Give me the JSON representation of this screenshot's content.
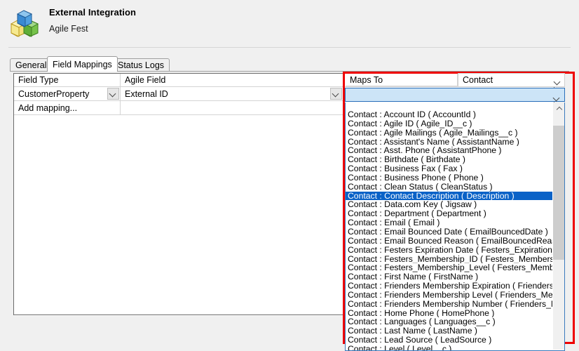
{
  "header": {
    "title": "External Integration",
    "subtitle": "Agile Fest",
    "icon": "blocks-icon"
  },
  "tabs": [
    {
      "label": "General",
      "active": false
    },
    {
      "label": "Field Mappings",
      "active": true
    },
    {
      "label": "Status Logs",
      "active": false
    }
  ],
  "grid": {
    "columns": [
      "Field Type",
      "Agile Field",
      "Maps To"
    ],
    "rows": [
      {
        "field_type": "CustomerProperty",
        "agile_field": "External ID",
        "maps_to": ""
      }
    ],
    "add_row_label": "Add mapping..."
  },
  "object_combo": {
    "value": "Contact",
    "icon": "chevron-down-icon"
  },
  "maps_to_combo": {
    "value": "",
    "icon": "chevron-down-icon",
    "expanded": true,
    "selected_index": 9,
    "scrollbar": {
      "up_icon": "chevron-up-icon",
      "thumb_top_pct": 4.8,
      "thumb_height_pct": 57
    },
    "options": [
      "Contact : Account ID ( AccountId )",
      "Contact : Agile ID ( Agile_ID__c )",
      "Contact : Agile Mailings ( Agile_Mailings__c )",
      "Contact : Assistant's Name ( AssistantName )",
      "Contact : Asst. Phone ( AssistantPhone )",
      "Contact : Birthdate ( Birthdate )",
      "Contact : Business Fax ( Fax )",
      "Contact : Business Phone ( Phone )",
      "Contact : Clean Status ( CleanStatus )",
      "Contact : Contact Description ( Description )",
      "Contact : Data.com Key ( Jigsaw )",
      "Contact : Department ( Department )",
      "Contact : Email ( Email )",
      "Contact : Email Bounced Date ( EmailBouncedDate )",
      "Contact : Email Bounced Reason ( EmailBouncedReason )",
      "Contact : Festers Expiration Date ( Festers_Expiration_Date__c )",
      "Contact : Festers_Membership_ID ( Festers_Membership_ID__c )",
      "Contact : Festers_Membership_Level ( Festers_Membership_Level__c )",
      "Contact : First Name ( FirstName )",
      "Contact : Frienders Membership Expiration ( Frienders_Membership_Expiration__c )",
      "Contact : Frienders Membership Level ( Frienders_Membership_Level__c )",
      "Contact : Frienders Membership Number ( Frienders_Membership_Number__c )",
      "Contact : Home Phone ( HomePhone )",
      "Contact : Languages ( Languages__c )",
      "Contact : Last Name ( LastName )",
      "Contact : Lead Source ( LeadSource )",
      "Contact : Level ( Level__c )"
    ]
  },
  "annotation": {
    "highlight_color": "#ee0000",
    "selection_color": "#0a62c7"
  }
}
